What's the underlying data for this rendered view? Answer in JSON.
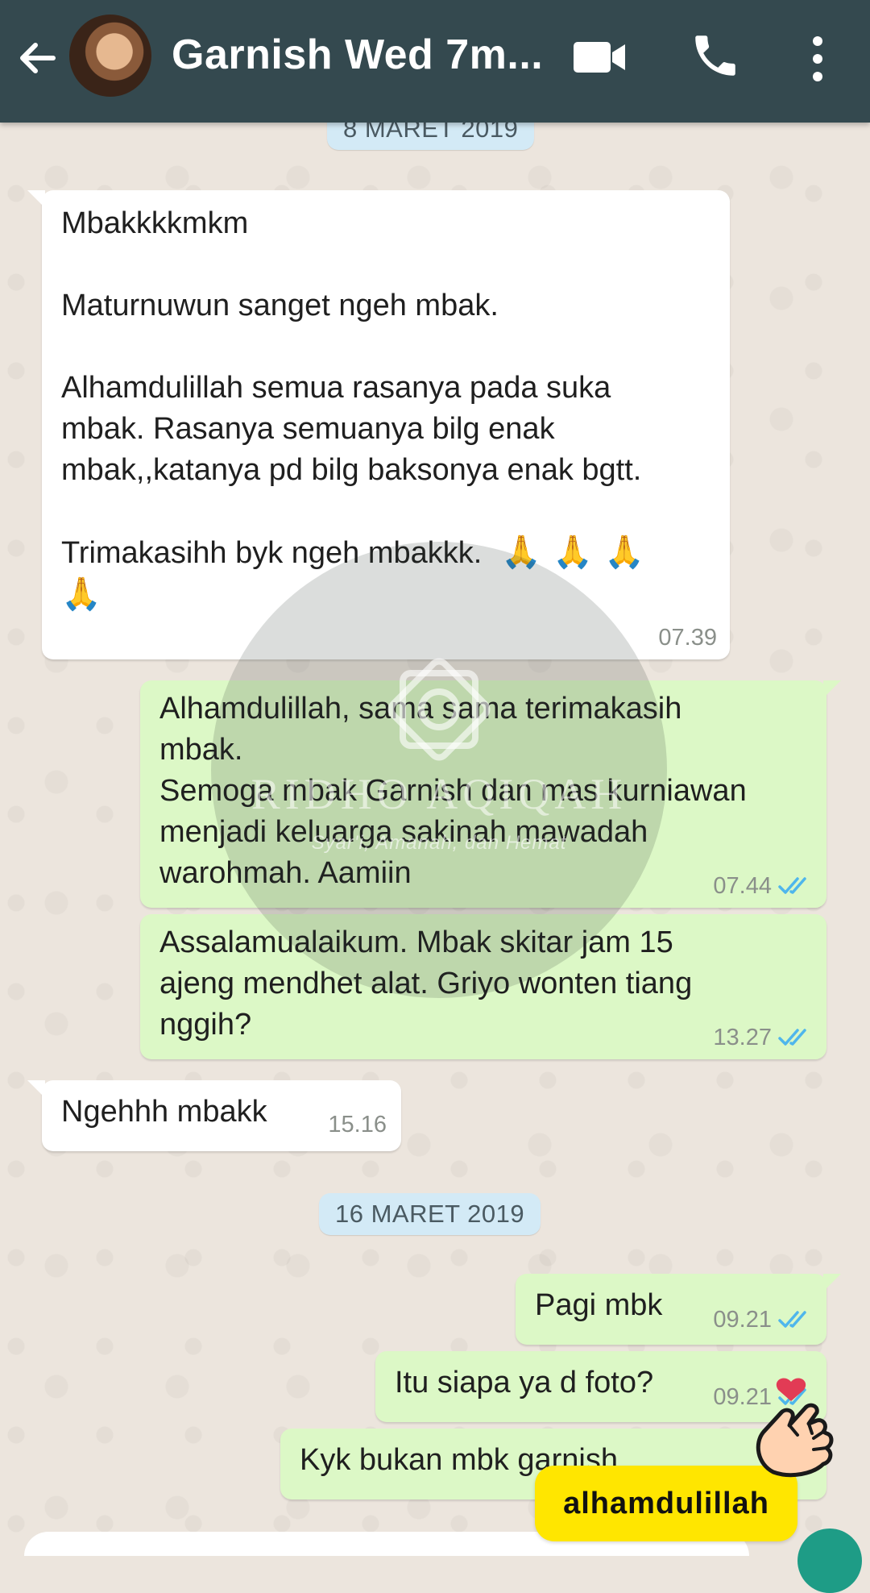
{
  "header": {
    "title": "Garnish Wed 7m...",
    "colors": {
      "bar": "#34494f",
      "text": "#ffffff"
    },
    "icons": [
      "back-arrow-icon",
      "video-call-icon",
      "phone-icon",
      "more-vert-icon"
    ]
  },
  "dates": {
    "first": "8 MARET 2019",
    "second": "16 MARET 2019"
  },
  "messages": {
    "m1": {
      "direction": "incoming",
      "line1": "Mbakkkkmkm",
      "line2": "Maturnuwun sanget ngeh mbak.",
      "line3": "Alhamdulillah semua rasanya pada suka",
      "line4": "mbak. Rasanya semuanya bilg enak",
      "line5": "mbak,,katanya pd bilg baksonya enak bgtt.",
      "line6": "Trimakasihh byk ngeh mbakkk.",
      "emoji": "🙏",
      "time": "07.39"
    },
    "m2": {
      "direction": "outgoing",
      "line1": "Alhamdulillah, sama sama terimakasih",
      "line2": "mbak.",
      "line3": "Semoga mbak Garnish dan mas kurniawan",
      "line4": "menjadi keluarga sakinah mawadah",
      "line5": "warohmah. Aamiin",
      "time": "07.44",
      "status": "read"
    },
    "m3": {
      "direction": "outgoing",
      "line1": "Assalamualaikum. Mbak skitar jam 15",
      "line2": "ajeng mendhet  alat. Griyo wonten tiang",
      "line3": "nggih?",
      "time": "13.27",
      "status": "read"
    },
    "m4": {
      "direction": "incoming",
      "text": "Ngehhh mbakk",
      "time": "15.16"
    },
    "m5": {
      "direction": "outgoing",
      "text": "Pagi mbk",
      "time": "09.21",
      "status": "read"
    },
    "m6": {
      "direction": "outgoing",
      "text": "Itu siapa ya d foto?",
      "time": "09.21",
      "status": "read"
    },
    "m7": {
      "direction": "outgoing",
      "text": "Kyk bukan mbk garnish"
    }
  },
  "watermark": {
    "name": "RIDHO AQIQAH",
    "tagline": "Syar'i, Amanah, dan Hemat"
  },
  "sticker": {
    "text": "alhamdulillah",
    "color": "#ffe600"
  },
  "colors": {
    "incoming_bubble": "#ffffff",
    "outgoing_bubble": "#dcf8c6",
    "read_ticks": "#4fb6ec",
    "background": "#ece5dd"
  }
}
